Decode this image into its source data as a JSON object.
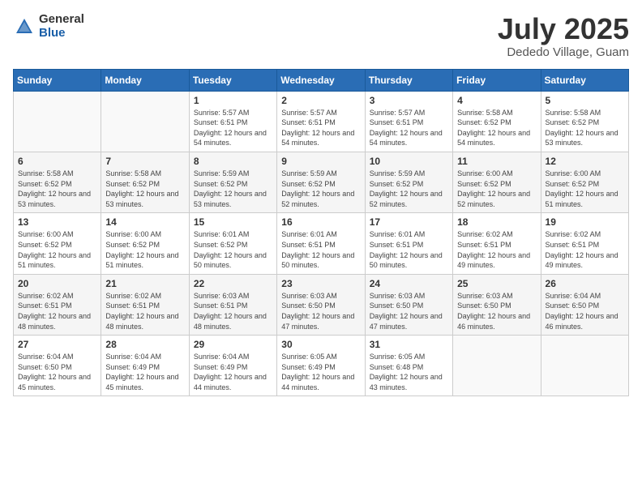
{
  "logo": {
    "general": "General",
    "blue": "Blue"
  },
  "header": {
    "month": "July 2025",
    "location": "Dededo Village, Guam"
  },
  "weekdays": [
    "Sunday",
    "Monday",
    "Tuesday",
    "Wednesday",
    "Thursday",
    "Friday",
    "Saturday"
  ],
  "weeks": [
    [
      {
        "day": "",
        "info": ""
      },
      {
        "day": "",
        "info": ""
      },
      {
        "day": "1",
        "info": "Sunrise: 5:57 AM\nSunset: 6:51 PM\nDaylight: 12 hours and 54 minutes."
      },
      {
        "day": "2",
        "info": "Sunrise: 5:57 AM\nSunset: 6:51 PM\nDaylight: 12 hours and 54 minutes."
      },
      {
        "day": "3",
        "info": "Sunrise: 5:57 AM\nSunset: 6:51 PM\nDaylight: 12 hours and 54 minutes."
      },
      {
        "day": "4",
        "info": "Sunrise: 5:58 AM\nSunset: 6:52 PM\nDaylight: 12 hours and 54 minutes."
      },
      {
        "day": "5",
        "info": "Sunrise: 5:58 AM\nSunset: 6:52 PM\nDaylight: 12 hours and 53 minutes."
      }
    ],
    [
      {
        "day": "6",
        "info": "Sunrise: 5:58 AM\nSunset: 6:52 PM\nDaylight: 12 hours and 53 minutes."
      },
      {
        "day": "7",
        "info": "Sunrise: 5:58 AM\nSunset: 6:52 PM\nDaylight: 12 hours and 53 minutes."
      },
      {
        "day": "8",
        "info": "Sunrise: 5:59 AM\nSunset: 6:52 PM\nDaylight: 12 hours and 53 minutes."
      },
      {
        "day": "9",
        "info": "Sunrise: 5:59 AM\nSunset: 6:52 PM\nDaylight: 12 hours and 52 minutes."
      },
      {
        "day": "10",
        "info": "Sunrise: 5:59 AM\nSunset: 6:52 PM\nDaylight: 12 hours and 52 minutes."
      },
      {
        "day": "11",
        "info": "Sunrise: 6:00 AM\nSunset: 6:52 PM\nDaylight: 12 hours and 52 minutes."
      },
      {
        "day": "12",
        "info": "Sunrise: 6:00 AM\nSunset: 6:52 PM\nDaylight: 12 hours and 51 minutes."
      }
    ],
    [
      {
        "day": "13",
        "info": "Sunrise: 6:00 AM\nSunset: 6:52 PM\nDaylight: 12 hours and 51 minutes."
      },
      {
        "day": "14",
        "info": "Sunrise: 6:00 AM\nSunset: 6:52 PM\nDaylight: 12 hours and 51 minutes."
      },
      {
        "day": "15",
        "info": "Sunrise: 6:01 AM\nSunset: 6:52 PM\nDaylight: 12 hours and 50 minutes."
      },
      {
        "day": "16",
        "info": "Sunrise: 6:01 AM\nSunset: 6:51 PM\nDaylight: 12 hours and 50 minutes."
      },
      {
        "day": "17",
        "info": "Sunrise: 6:01 AM\nSunset: 6:51 PM\nDaylight: 12 hours and 50 minutes."
      },
      {
        "day": "18",
        "info": "Sunrise: 6:02 AM\nSunset: 6:51 PM\nDaylight: 12 hours and 49 minutes."
      },
      {
        "day": "19",
        "info": "Sunrise: 6:02 AM\nSunset: 6:51 PM\nDaylight: 12 hours and 49 minutes."
      }
    ],
    [
      {
        "day": "20",
        "info": "Sunrise: 6:02 AM\nSunset: 6:51 PM\nDaylight: 12 hours and 48 minutes."
      },
      {
        "day": "21",
        "info": "Sunrise: 6:02 AM\nSunset: 6:51 PM\nDaylight: 12 hours and 48 minutes."
      },
      {
        "day": "22",
        "info": "Sunrise: 6:03 AM\nSunset: 6:51 PM\nDaylight: 12 hours and 48 minutes."
      },
      {
        "day": "23",
        "info": "Sunrise: 6:03 AM\nSunset: 6:50 PM\nDaylight: 12 hours and 47 minutes."
      },
      {
        "day": "24",
        "info": "Sunrise: 6:03 AM\nSunset: 6:50 PM\nDaylight: 12 hours and 47 minutes."
      },
      {
        "day": "25",
        "info": "Sunrise: 6:03 AM\nSunset: 6:50 PM\nDaylight: 12 hours and 46 minutes."
      },
      {
        "day": "26",
        "info": "Sunrise: 6:04 AM\nSunset: 6:50 PM\nDaylight: 12 hours and 46 minutes."
      }
    ],
    [
      {
        "day": "27",
        "info": "Sunrise: 6:04 AM\nSunset: 6:50 PM\nDaylight: 12 hours and 45 minutes."
      },
      {
        "day": "28",
        "info": "Sunrise: 6:04 AM\nSunset: 6:49 PM\nDaylight: 12 hours and 45 minutes."
      },
      {
        "day": "29",
        "info": "Sunrise: 6:04 AM\nSunset: 6:49 PM\nDaylight: 12 hours and 44 minutes."
      },
      {
        "day": "30",
        "info": "Sunrise: 6:05 AM\nSunset: 6:49 PM\nDaylight: 12 hours and 44 minutes."
      },
      {
        "day": "31",
        "info": "Sunrise: 6:05 AM\nSunset: 6:48 PM\nDaylight: 12 hours and 43 minutes."
      },
      {
        "day": "",
        "info": ""
      },
      {
        "day": "",
        "info": ""
      }
    ]
  ]
}
